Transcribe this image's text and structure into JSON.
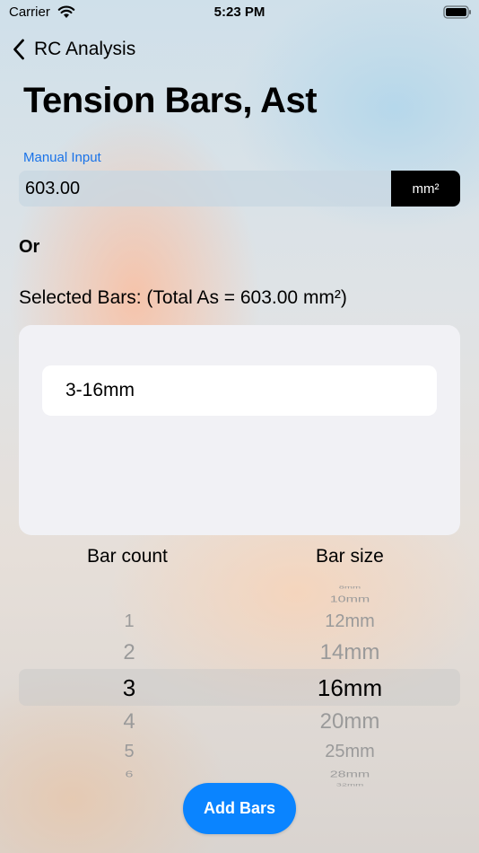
{
  "status_bar": {
    "carrier": "Carrier",
    "time": "5:23 PM"
  },
  "nav": {
    "back_label": "RC Analysis"
  },
  "page_title": "Tension Bars, Ast",
  "manual_input": {
    "label": "Manual Input",
    "value": "603.00",
    "unit": "mm²"
  },
  "or_label": "Or",
  "selected_bars_label": "Selected Bars: (Total As = 603.00 mm²)",
  "selected_bars": [
    "3-16mm"
  ],
  "picker": {
    "bar_count_header": "Bar count",
    "bar_size_header": "Bar size",
    "bar_counts": [
      "1",
      "2",
      "3",
      "4",
      "5",
      "6"
    ],
    "selected_count": "3",
    "bar_sizes": [
      "8mm",
      "10mm",
      "12mm",
      "14mm",
      "16mm",
      "20mm",
      "25mm",
      "28mm",
      "32mm"
    ],
    "selected_size": "16mm"
  },
  "add_bars_label": "Add Bars",
  "colors": {
    "accent": "#0a84ff",
    "label_blue": "#1a73e8",
    "unit_button": "#000000"
  },
  "icons": {
    "wifi": "wifi-icon",
    "battery": "battery-icon",
    "back": "chevron-left-icon"
  }
}
